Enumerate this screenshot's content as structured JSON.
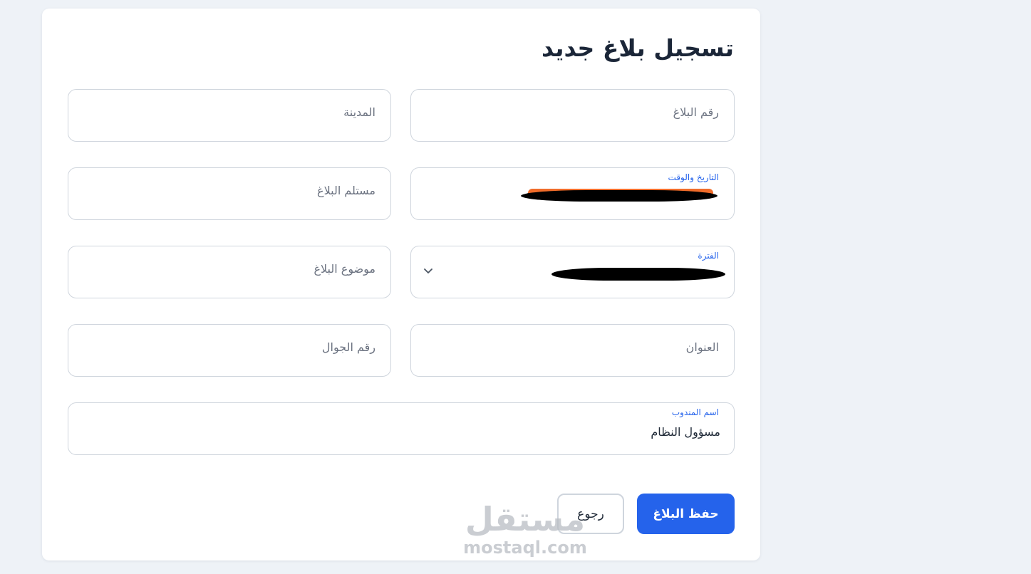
{
  "form": {
    "title": "تسجيل بلاغ جديد",
    "fields": {
      "report_number": {
        "placeholder": "رقم البلاغ"
      },
      "city": {
        "placeholder": "المدينة"
      },
      "datetime": {
        "label": "التاريخ والوقت",
        "value": "[redacted]"
      },
      "receiver": {
        "placeholder": "مستلم البلاغ"
      },
      "period": {
        "label": "الفترة",
        "value": "[redacted]",
        "icon": "chevron-down-icon"
      },
      "subject": {
        "placeholder": "موضوع البلاغ"
      },
      "address": {
        "placeholder": "العنوان"
      },
      "mobile": {
        "placeholder": "رقم الجوال"
      },
      "agent_name": {
        "label": "اسم المندوب",
        "value": "مسؤول النظام"
      }
    },
    "buttons": {
      "save_label": "حفظ البلاغ",
      "back_label": "رجوع"
    }
  },
  "watermark": {
    "logo_text": "مستقل",
    "url": "mostaql.com"
  },
  "colors": {
    "page_background": "#eef2f7",
    "card_background": "#ffffff",
    "accent": "#2563eb",
    "border": "#cfd5dd",
    "title_text": "#1b2638"
  }
}
